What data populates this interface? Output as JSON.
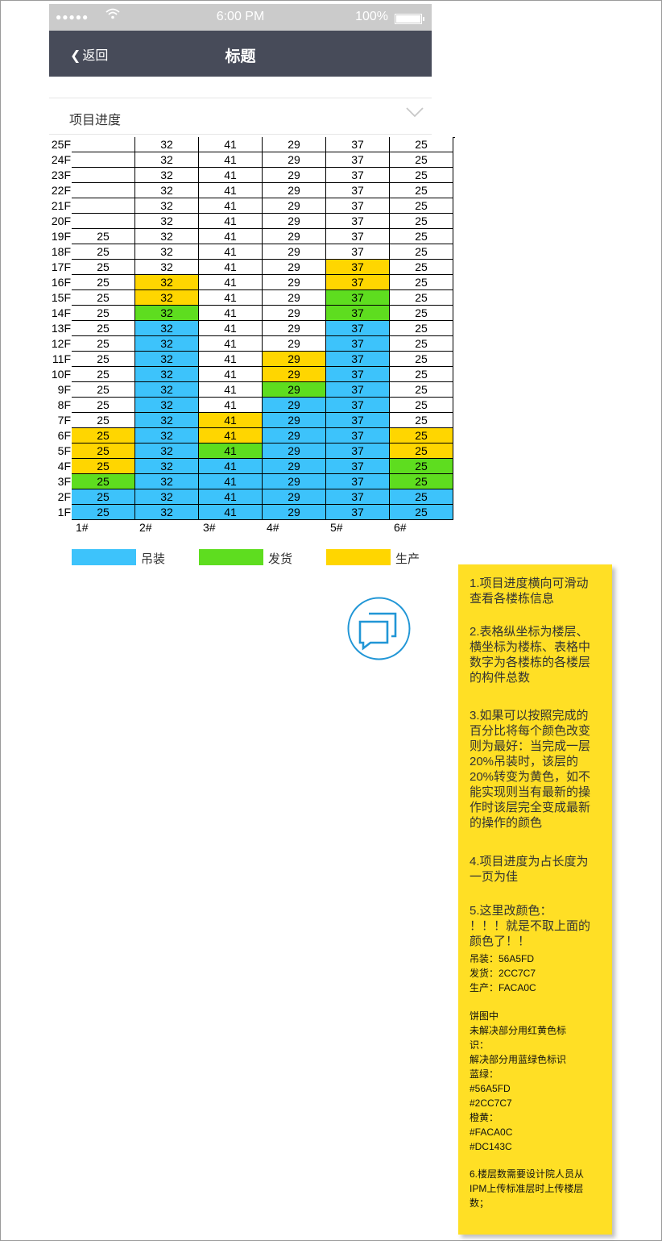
{
  "status_bar": {
    "dots": "●●●●●",
    "time": "6:00 PM",
    "battery": "100%"
  },
  "nav": {
    "back_label": "返回",
    "title": "标题"
  },
  "section": {
    "title": "项目进度"
  },
  "floors": [
    "25F",
    "24F",
    "23F",
    "22F",
    "21F",
    "20F",
    "19F",
    "18F",
    "17F",
    "16F",
    "15F",
    "14F",
    "13F",
    "12F",
    "11F",
    "10F",
    "9F",
    "8F",
    "7F",
    "6F",
    "5F",
    "4F",
    "3F",
    "2F",
    "1F"
  ],
  "buildings": [
    "1#",
    "2#",
    "3#",
    "4#",
    "5#",
    "6#"
  ],
  "legend": [
    {
      "label": "吊装",
      "color": "#3dc3fb"
    },
    {
      "label": "发货",
      "color": "#5edd1f"
    },
    {
      "label": "生产",
      "color": "#ffd600"
    }
  ],
  "status_colors": {
    "B": "#3dc3fb",
    "G": "#5edd1f",
    "Y": "#ffd600",
    "W": "#ffffff"
  },
  "grid": {
    "values": [
      [
        "",
        "32",
        "41",
        "29",
        "37",
        "25"
      ],
      [
        "",
        "32",
        "41",
        "29",
        "37",
        "25"
      ],
      [
        "",
        "32",
        "41",
        "29",
        "37",
        "25"
      ],
      [
        "",
        "32",
        "41",
        "29",
        "37",
        "25"
      ],
      [
        "",
        "32",
        "41",
        "29",
        "37",
        "25"
      ],
      [
        "",
        "32",
        "41",
        "29",
        "37",
        "25"
      ],
      [
        "25",
        "32",
        "41",
        "29",
        "37",
        "25"
      ],
      [
        "25",
        "32",
        "41",
        "29",
        "37",
        "25"
      ],
      [
        "25",
        "32",
        "41",
        "29",
        "37",
        "25"
      ],
      [
        "25",
        "32",
        "41",
        "29",
        "37",
        "25"
      ],
      [
        "25",
        "32",
        "41",
        "29",
        "37",
        "25"
      ],
      [
        "25",
        "32",
        "41",
        "29",
        "37",
        "25"
      ],
      [
        "25",
        "32",
        "41",
        "29",
        "37",
        "25"
      ],
      [
        "25",
        "32",
        "41",
        "29",
        "37",
        "25"
      ],
      [
        "25",
        "32",
        "41",
        "29",
        "37",
        "25"
      ],
      [
        "25",
        "32",
        "41",
        "29",
        "37",
        "25"
      ],
      [
        "25",
        "32",
        "41",
        "29",
        "37",
        "25"
      ],
      [
        "25",
        "32",
        "41",
        "29",
        "37",
        "25"
      ],
      [
        "25",
        "32",
        "41",
        "29",
        "37",
        "25"
      ],
      [
        "25",
        "32",
        "41",
        "29",
        "37",
        "25"
      ],
      [
        "25",
        "32",
        "41",
        "29",
        "37",
        "25"
      ],
      [
        "25",
        "32",
        "41",
        "29",
        "37",
        "25"
      ],
      [
        "25",
        "32",
        "41",
        "29",
        "37",
        "25"
      ],
      [
        "25",
        "32",
        "41",
        "29",
        "37",
        "25"
      ],
      [
        "25",
        "32",
        "41",
        "29",
        "37",
        "25"
      ]
    ],
    "status": [
      "WWWWWW",
      "WWWWWW",
      "WWWWWW",
      "WWWWWW",
      "WWWWWW",
      "WWWWWW",
      "WWWWWW",
      "WWWWWW",
      "WWWWYW",
      "WYWWYW",
      "WYWWGW",
      "WGWWGW",
      "WBWWBW",
      "WBWWBW",
      "WBWYBW",
      "WBWYBW",
      "WBWGBW",
      "WBWBBW",
      "WBYBBW",
      "YBYBBY",
      "YBGBBY",
      "YBBBBG",
      "GBBBBG",
      "BBBBBB",
      "BBBBBB"
    ]
  },
  "note": {
    "p1": "1.项目进度横向可滑动\n查看各楼栋信息",
    "p2": "2.表格纵坐标为楼层、\n横坐标为楼栋、表格中\n数字为各楼栋的各楼层\n的构件总数",
    "p3": "3.如果可以按照完成的\n百分比将每个颜色改变\n则为最好：当完成一层\n20%吊装时，该层的\n20%转变为黄色，如不\n能实现则当有最新的操\n作时该层完全变成最新\n的操作的颜色",
    "p4": "4.项目进度为占长度为\n一页为佳",
    "p5": "5.这里改颜色：\n！！！就是不取上面的\n颜色了！！",
    "p5_small": "吊装：56A5FD\n发货：2CC7C7\n生产：FACA0C",
    "pie": "饼图中\n未解决部分用红黄色标\n识：\n解决部分用蓝绿色标识\n蓝绿：\n#56A5FD\n#2CC7C7\n橙黄：\n#FACA0C\n#DC143C",
    "p6": "6.楼层数需要设计院人员从\nIPM上传标准层时上传楼层\n数；"
  }
}
